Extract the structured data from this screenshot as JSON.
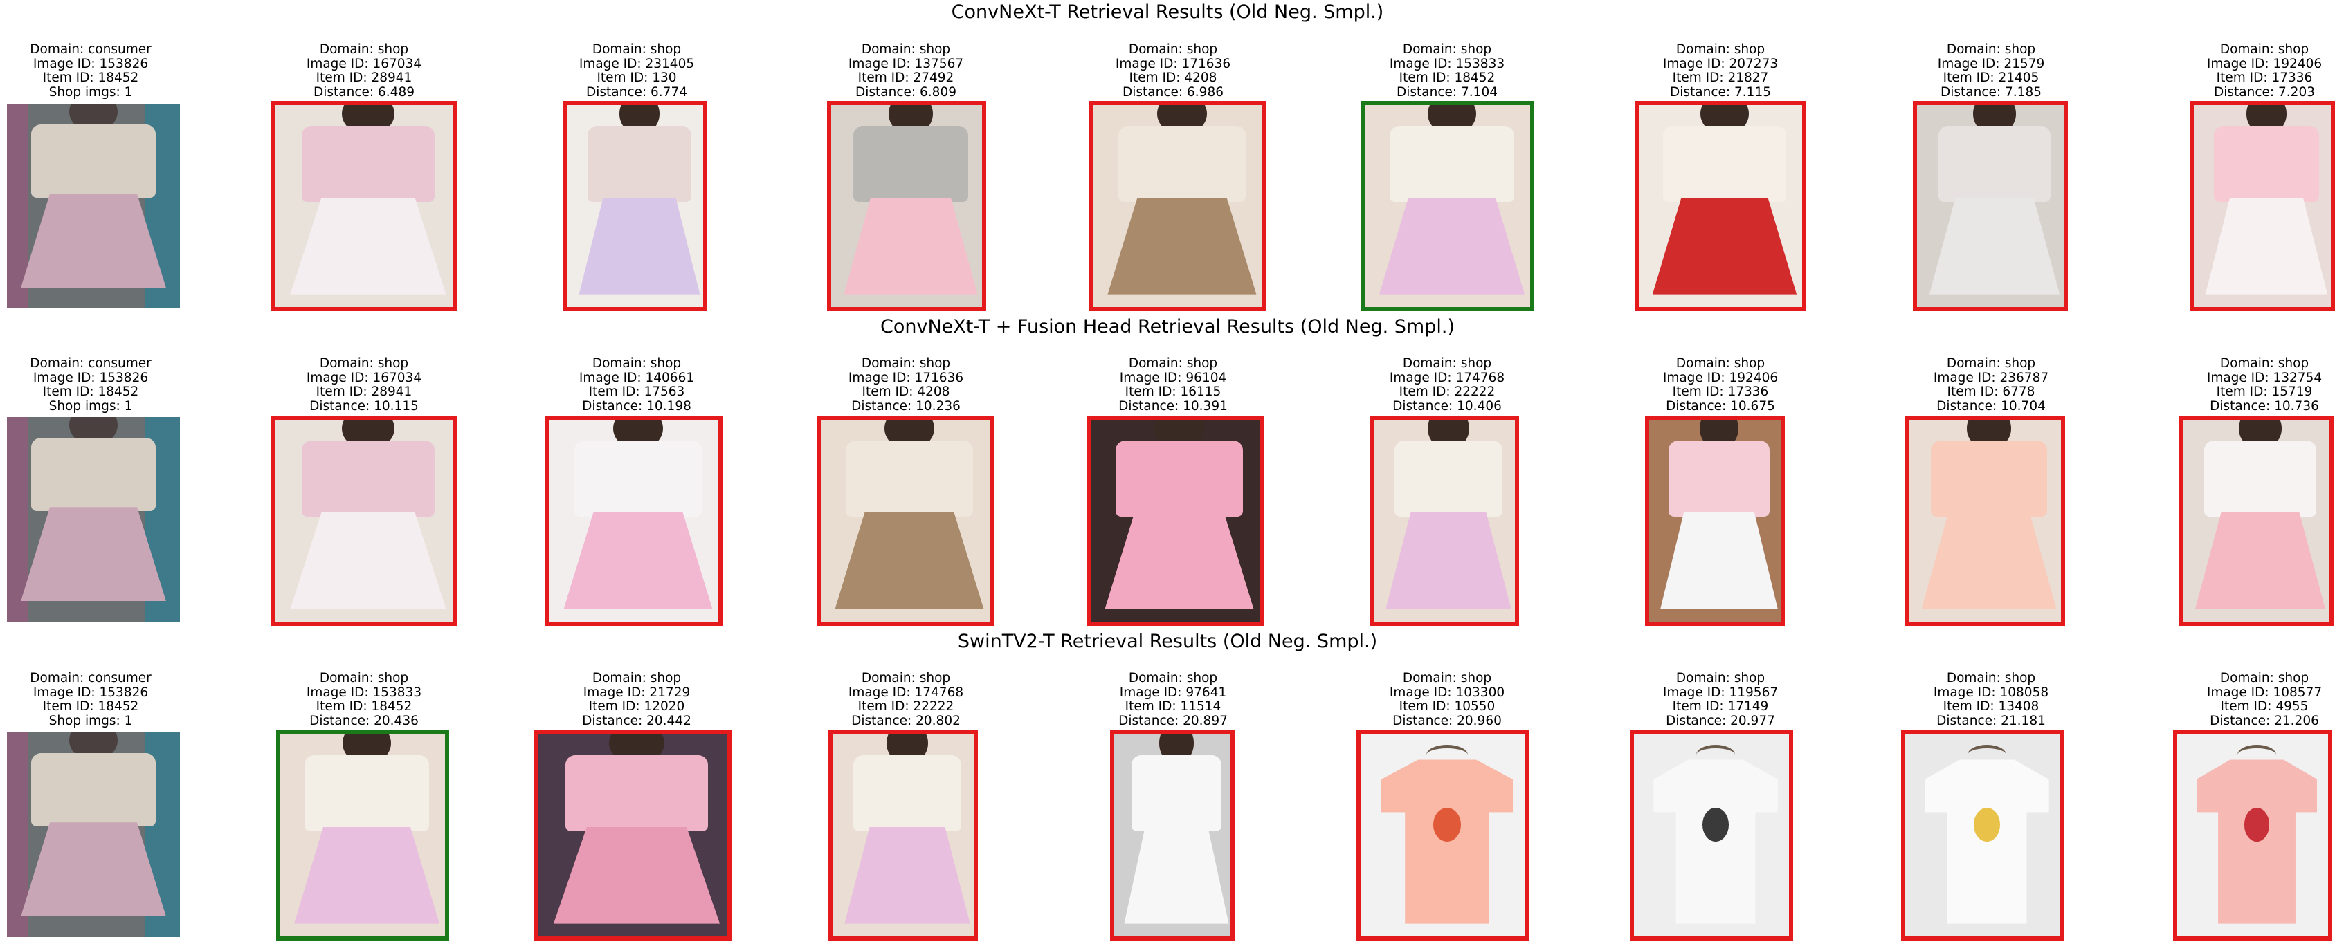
{
  "rows": [
    {
      "title": "ConvNeXt-T Retrieval Results (Old Neg. Smpl.)",
      "query": {
        "domain": "Domain: consumer",
        "image_id": "Image ID: 153826",
        "item_id": "Item ID: 18452",
        "extra": "Shop imgs: 1"
      },
      "results": [
        {
          "domain": "Domain: shop",
          "image_id": "Image ID: 167034",
          "item_id": "Item ID: 28941",
          "distance": "Distance: 6.489",
          "match": false
        },
        {
          "domain": "Domain: shop",
          "image_id": "Image ID: 231405",
          "item_id": "Item ID: 130",
          "distance": "Distance: 6.774",
          "match": false
        },
        {
          "domain": "Domain: shop",
          "image_id": "Image ID: 137567",
          "item_id": "Item ID: 27492",
          "distance": "Distance: 6.809",
          "match": false
        },
        {
          "domain": "Domain: shop",
          "image_id": "Image ID: 171636",
          "item_id": "Item ID: 4208",
          "distance": "Distance: 6.986",
          "match": false
        },
        {
          "domain": "Domain: shop",
          "image_id": "Image ID: 153833",
          "item_id": "Item ID: 18452",
          "distance": "Distance: 7.104",
          "match": true
        },
        {
          "domain": "Domain: shop",
          "image_id": "Image ID: 207273",
          "item_id": "Item ID: 21827",
          "distance": "Distance: 7.115",
          "match": false
        },
        {
          "domain": "Domain: shop",
          "image_id": "Image ID: 21579",
          "item_id": "Item ID: 21405",
          "distance": "Distance: 7.185",
          "match": false
        },
        {
          "domain": "Domain: shop",
          "image_id": "Image ID: 192406",
          "item_id": "Item ID: 17336",
          "distance": "Distance: 7.203",
          "match": false
        }
      ]
    },
    {
      "title": "ConvNeXt-T + Fusion Head Retrieval Results (Old Neg. Smpl.)",
      "query": {
        "domain": "Domain: consumer",
        "image_id": "Image ID: 153826",
        "item_id": "Item ID: 18452",
        "extra": "Shop imgs: 1"
      },
      "results": [
        {
          "domain": "Domain: shop",
          "image_id": "Image ID: 167034",
          "item_id": "Item ID: 28941",
          "distance": "Distance: 10.115",
          "match": false
        },
        {
          "domain": "Domain: shop",
          "image_id": "Image ID: 140661",
          "item_id": "Item ID: 17563",
          "distance": "Distance: 10.198",
          "match": false
        },
        {
          "domain": "Domain: shop",
          "image_id": "Image ID: 171636",
          "item_id": "Item ID: 4208",
          "distance": "Distance: 10.236",
          "match": false
        },
        {
          "domain": "Domain: shop",
          "image_id": "Image ID: 96104",
          "item_id": "Item ID: 16115",
          "distance": "Distance: 10.391",
          "match": false
        },
        {
          "domain": "Domain: shop",
          "image_id": "Image ID: 174768",
          "item_id": "Item ID: 22222",
          "distance": "Distance: 10.406",
          "match": false
        },
        {
          "domain": "Domain: shop",
          "image_id": "Image ID: 192406",
          "item_id": "Item ID: 17336",
          "distance": "Distance: 10.675",
          "match": false
        },
        {
          "domain": "Domain: shop",
          "image_id": "Image ID: 236787",
          "item_id": "Item ID: 6778",
          "distance": "Distance: 10.704",
          "match": false
        },
        {
          "domain": "Domain: shop",
          "image_id": "Image ID: 132754",
          "item_id": "Item ID: 15719",
          "distance": "Distance: 10.736",
          "match": false
        }
      ]
    },
    {
      "title": "SwinTV2-T Retrieval Results (Old Neg. Smpl.)",
      "query": {
        "domain": "Domain: consumer",
        "image_id": "Image ID: 153826",
        "item_id": "Item ID: 18452",
        "extra": "Shop imgs: 1"
      },
      "results": [
        {
          "domain": "Domain: shop",
          "image_id": "Image ID: 153833",
          "item_id": "Item ID: 18452",
          "distance": "Distance: 20.436",
          "match": true
        },
        {
          "domain": "Domain: shop",
          "image_id": "Image ID: 21729",
          "item_id": "Item ID: 12020",
          "distance": "Distance: 20.442",
          "match": false
        },
        {
          "domain": "Domain: shop",
          "image_id": "Image ID: 174768",
          "item_id": "Item ID: 22222",
          "distance": "Distance: 20.802",
          "match": false
        },
        {
          "domain": "Domain: shop",
          "image_id": "Image ID: 97641",
          "item_id": "Item ID: 11514",
          "distance": "Distance: 20.897",
          "match": false
        },
        {
          "domain": "Domain: shop",
          "image_id": "Image ID: 103300",
          "item_id": "Item ID: 10550",
          "distance": "Distance: 20.960",
          "match": false
        },
        {
          "domain": "Domain: shop",
          "image_id": "Image ID: 119567",
          "item_id": "Item ID: 17149",
          "distance": "Distance: 20.977",
          "match": false
        },
        {
          "domain": "Domain: shop",
          "image_id": "Image ID: 108058",
          "item_id": "Item ID: 13408",
          "distance": "Distance: 21.181",
          "match": false
        },
        {
          "domain": "Domain: shop",
          "image_id": "Image ID: 108577",
          "item_id": "Item ID: 4955",
          "distance": "Distance: 21.206",
          "match": false
        }
      ]
    }
  ],
  "colors": {
    "match_border": "#1a7a1a",
    "mismatch_border": "#e41a1c"
  }
}
